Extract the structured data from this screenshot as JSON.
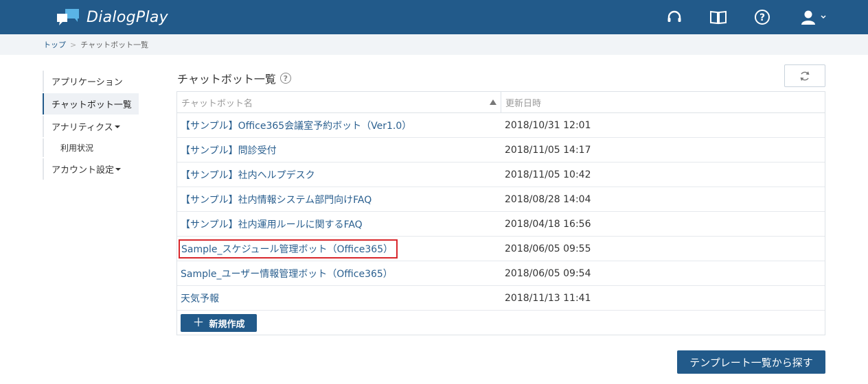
{
  "app": {
    "name": "DialogPlay"
  },
  "colors": {
    "header": "#225a8a",
    "link": "#2a5f8f",
    "highlight": "#d8262b"
  },
  "header_icons": [
    "headset-icon",
    "book-icon",
    "help-icon",
    "user-icon",
    "chevron-down-icon"
  ],
  "breadcrumb": {
    "home": "トップ",
    "separator": ">",
    "current": "チャットボット一覧"
  },
  "sidebar": {
    "items": [
      {
        "label": "アプリケーション"
      },
      {
        "label": "チャットボット一覧"
      },
      {
        "label": "アナリティクス"
      },
      {
        "label": "利用状況"
      },
      {
        "label": "アカウント設定"
      }
    ]
  },
  "main": {
    "title": "チャットボット一覧",
    "help": "?"
  },
  "table": {
    "headers": {
      "name": "チャットボット名",
      "date": "更新日時"
    },
    "rows": [
      {
        "name": "【サンプル】Office365会議室予約ボット（Ver1.0）",
        "date": "2018/10/31 12:01"
      },
      {
        "name": "【サンプル】問診受付",
        "date": "2018/11/05 14:17"
      },
      {
        "name": "【サンプル】社内ヘルプデスク",
        "date": "2018/11/05 10:42"
      },
      {
        "name": "【サンプル】社内情報システム部門向けFAQ",
        "date": "2018/08/28 14:04"
      },
      {
        "name": "【サンプル】社内運用ルールに関するFAQ",
        "date": "2018/04/18 16:56"
      },
      {
        "name": "Sample_スケジュール管理ボット（Office365）",
        "date": "2018/06/05 09:55"
      },
      {
        "name": "Sample_ユーザー情報管理ボット（Office365）",
        "date": "2018/06/05 09:54"
      },
      {
        "name": "天気予報",
        "date": "2018/11/13 11:41"
      }
    ],
    "new_button": "新規作成"
  },
  "template_button": "テンプレート一覧から探す"
}
